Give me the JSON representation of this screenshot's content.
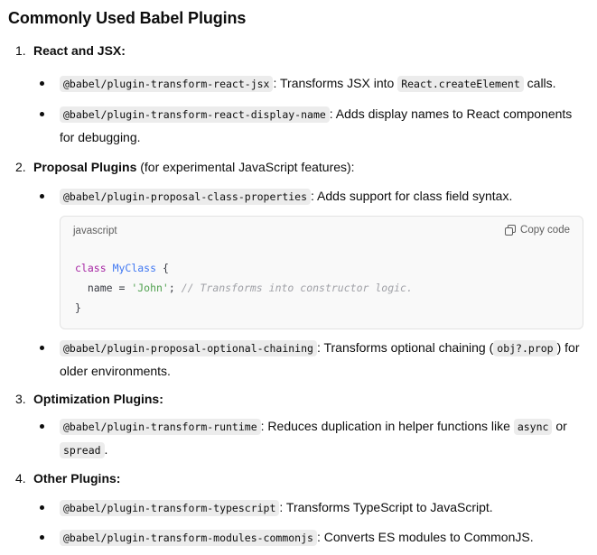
{
  "title": "Commonly Used Babel Plugins",
  "sections": [
    {
      "num": "1.",
      "title": "React and JSX:",
      "suffix": "",
      "items": [
        {
          "code": "@babel/plugin-transform-react-jsx",
          "text_a": ": Transforms JSX into ",
          "code2": "React.createElement",
          "text_b": " calls."
        },
        {
          "code": "@babel/plugin-transform-react-display-name",
          "text_a": ": Adds display names to React components for debugging."
        }
      ]
    },
    {
      "num": "2.",
      "title": "Proposal Plugins",
      "suffix": " (for experimental JavaScript features):",
      "items": [
        {
          "code": "@babel/plugin-proposal-class-properties",
          "text_a": ": Adds support for class field syntax."
        },
        {
          "code": "@babel/plugin-proposal-optional-chaining",
          "text_a": ": Transforms optional chaining (",
          "code2": "obj?.prop",
          "text_b": ") for older environments."
        }
      ],
      "codeblock": {
        "language": "javascript",
        "copy_label": "Copy code",
        "line1_kw": "class",
        "line1_cls": "MyClass",
        "line1_rest": " {",
        "line2_a": "  name = ",
        "line2_str": "'John'",
        "line2_b": "; ",
        "line2_cmt": "// Transforms into constructor logic.",
        "line3": "}"
      }
    },
    {
      "num": "3.",
      "title": "Optimization Plugins:",
      "suffix": "",
      "items": [
        {
          "code": "@babel/plugin-transform-runtime",
          "text_a": ": Reduces duplication in helper functions like ",
          "code2": "async",
          "text_b": " or ",
          "code3": "spread",
          "text_c": "."
        }
      ]
    },
    {
      "num": "4.",
      "title": "Other Plugins:",
      "suffix": "",
      "items": [
        {
          "code": "@babel/plugin-transform-typescript",
          "text_a": ": Transforms TypeScript to JavaScript."
        },
        {
          "code": "@babel/plugin-transform-modules-commonjs",
          "text_a": ": Converts ES modules to CommonJS."
        }
      ]
    }
  ]
}
